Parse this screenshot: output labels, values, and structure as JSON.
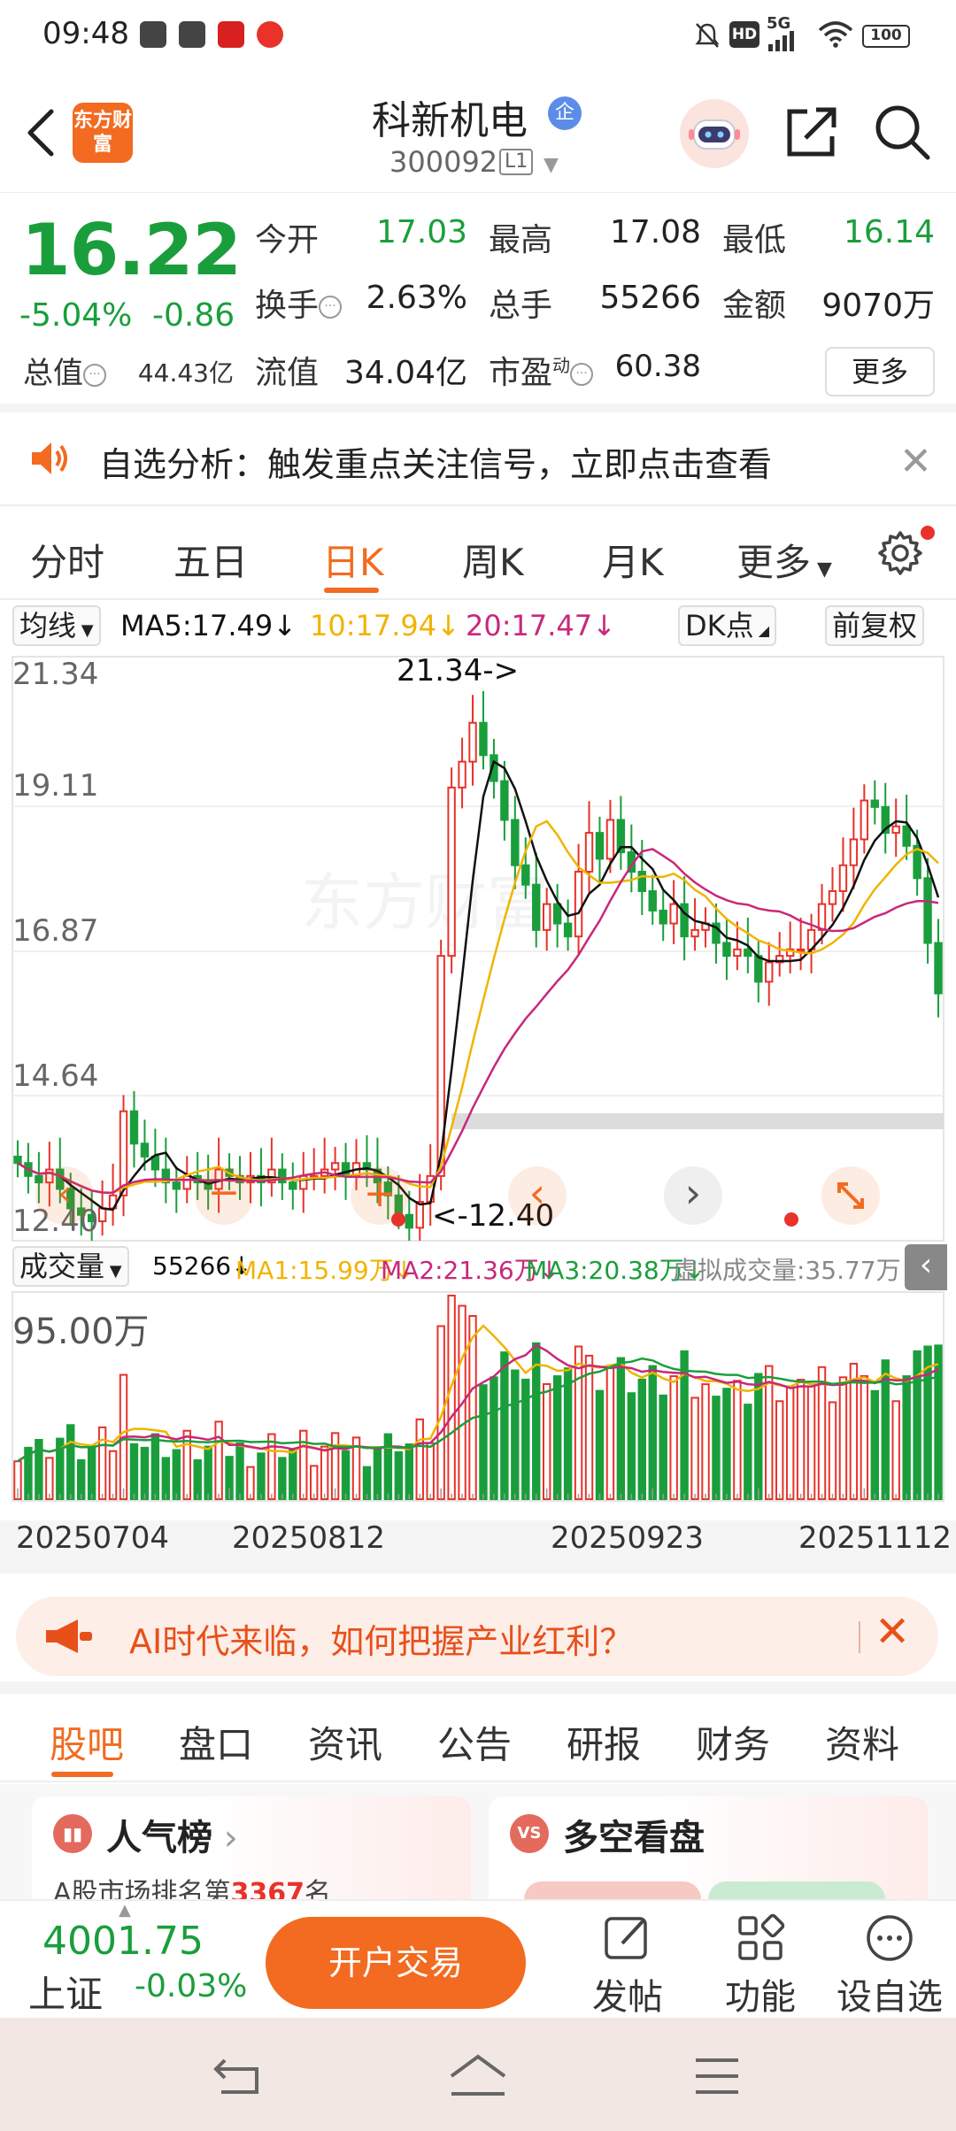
{
  "status_bar": {
    "time": "09:48",
    "network": "5G",
    "battery": "100"
  },
  "header": {
    "logo_text": "东方财富",
    "stock_name": "科新机电",
    "badge": "企",
    "stock_code": "300092",
    "level": "L1"
  },
  "quote": {
    "price": "16.22",
    "change_pct": "-5.04%",
    "change_abs": "-0.86",
    "open_label": "今开",
    "open": "17.03",
    "high_label": "最高",
    "high": "17.08",
    "low_label": "最低",
    "low": "16.14",
    "turnover_label": "换手",
    "turnover": "2.63%",
    "volume_label": "总手",
    "volume": "55266",
    "amount_label": "金额",
    "amount": "9070万",
    "mktcap_label": "总值",
    "mktcap": "44.43亿",
    "float_label": "流值",
    "float_cap": "34.04亿",
    "pe_label": "市盈",
    "pe_sup": "动",
    "pe": "60.38",
    "more_label": "更多"
  },
  "alert": {
    "text": "自选分析：触发重点关注信号，立即点击查看"
  },
  "period_tabs": [
    {
      "label": "分时"
    },
    {
      "label": "五日"
    },
    {
      "label": "日K"
    },
    {
      "label": "周K"
    },
    {
      "label": "月K"
    },
    {
      "label": "更多"
    }
  ],
  "ma": {
    "selector": "均线",
    "ma5": "MA5:17.49",
    "ma10": "10:17.94",
    "ma20": "20:17.47",
    "dk": "DK点",
    "adjust": "前复权"
  },
  "kline": {
    "y_ticks": [
      "21.34",
      "19.11",
      "16.87",
      "14.64",
      "12.40"
    ],
    "max_label": "21.34->",
    "min_label": "<-12.40",
    "watermark": "东方财富"
  },
  "volume_row": {
    "selector": "成交量",
    "vol": "55266",
    "ma1": "MA1:15.99万",
    "ma2": "MA2:21.36万",
    "ma3": "MA3:20.38万",
    "virtual": "虚拟成交量:35.77万",
    "max_label": "95.00万"
  },
  "dates": [
    "20250704",
    "20250812",
    "20250923",
    "20251112"
  ],
  "ai_banner": {
    "text": "AI时代来临，如何把握产业红利？"
  },
  "section_tabs": [
    {
      "label": "股吧"
    },
    {
      "label": "盘口"
    },
    {
      "label": "资讯"
    },
    {
      "label": "公告"
    },
    {
      "label": "研报"
    },
    {
      "label": "财务"
    },
    {
      "label": "资料"
    }
  ],
  "cards": [
    {
      "title": "人气榜",
      "subtitle": "A股市场排名第",
      "rank": "3367",
      "suffix": "名"
    },
    {
      "title": "多空看盘"
    }
  ],
  "bottom_bar": {
    "index_value": "4001.75",
    "index_name": "上证",
    "index_change": "-0.03%",
    "trade_label": "开户交易",
    "post_label": "发帖",
    "func_label": "功能",
    "watch_label": "设自选"
  },
  "colors": {
    "accent": "#f26b21",
    "up": "#e8322a",
    "down": "#1a9e3c",
    "ma5": "#111111",
    "ma10": "#f0b400",
    "ma20": "#c8287a"
  },
  "chart_data": {
    "type": "candlestick",
    "ylim": [
      12.4,
      21.34
    ],
    "max": 21.34,
    "min": 12.4,
    "close_series": [
      13.6,
      13.4,
      13.3,
      13.5,
      13.2,
      12.9,
      12.8,
      12.7,
      12.9,
      13.1,
      14.4,
      13.9,
      13.7,
      13.5,
      13.3,
      13.2,
      13.4,
      13.3,
      13.2,
      13.5,
      13.4,
      13.3,
      13.4,
      13.3,
      13.5,
      13.3,
      13.2,
      13.4,
      13.4,
      13.5,
      13.6,
      13.4,
      13.6,
      13.5,
      13.3,
      13.1,
      12.8,
      12.6,
      13.0,
      13.4,
      16.8,
      19.4,
      19.8,
      20.4,
      19.9,
      19.5,
      18.9,
      18.2,
      17.9,
      17.2,
      17.6,
      17.3,
      17.1,
      18.1,
      18.7,
      18.3,
      18.9,
      18.4,
      18.1,
      17.8,
      17.5,
      17.3,
      17.6,
      17.1,
      17.2,
      17.3,
      17.0,
      16.8,
      16.9,
      16.8,
      16.4,
      16.7,
      16.8,
      16.9,
      16.9,
      17.2,
      17.6,
      17.8,
      18.2,
      18.6,
      19.2,
      19.1,
      18.7,
      18.8,
      18.5,
      18.0,
      17.0,
      16.22
    ],
    "volume_max": 950000
  }
}
